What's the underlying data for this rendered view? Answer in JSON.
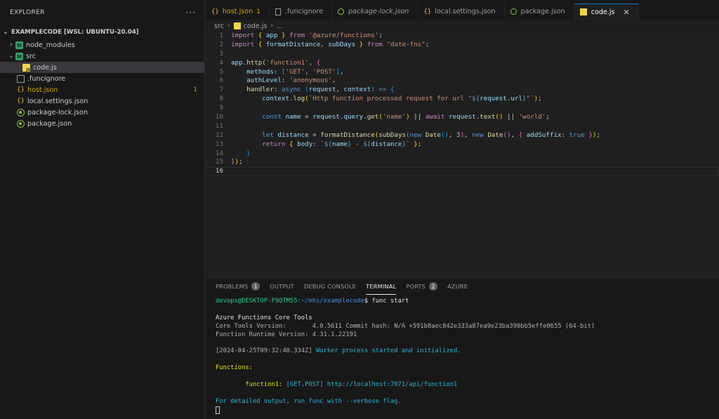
{
  "explorer": {
    "title": "EXPLORER",
    "more": "···",
    "workspace": "EXAMPLECODE [WSL: UBUNTU-20.04]",
    "items": [
      {
        "label": "node_modules",
        "icon": "folder-icon",
        "chevron": "›"
      },
      {
        "label": "src",
        "icon": "folder-icon",
        "chevron": "⌄"
      },
      {
        "label": "code.js",
        "icon": "js-file-icon"
      },
      {
        "label": ".funcignore",
        "icon": "file-icon"
      },
      {
        "label": "host.json",
        "icon": "json-icon",
        "badge": "1"
      },
      {
        "label": "local.settings.json",
        "icon": "json-icon"
      },
      {
        "label": "package-lock.json",
        "icon": "npm-icon"
      },
      {
        "label": "package.json",
        "icon": "npm-icon"
      }
    ]
  },
  "tabs": [
    {
      "label": "host.json",
      "icon": "{}",
      "badge": "1"
    },
    {
      "label": ".funcignore"
    },
    {
      "label": "package-lock.json"
    },
    {
      "label": "local.settings.json",
      "icon": "{}"
    },
    {
      "label": "package.json"
    },
    {
      "label": "code.js",
      "close": "✕"
    }
  ],
  "breadcrumb": {
    "folder": "src",
    "sep": "›",
    "file": "code.js",
    "sep2": "›",
    "rest": "..."
  },
  "editor": {
    "line_numbers": [
      "1",
      "2",
      "3",
      "4",
      "5",
      "6",
      "7",
      "8",
      "9",
      "10",
      "11",
      "12",
      "13",
      "14",
      "15",
      "16"
    ]
  },
  "panel": {
    "tabs": [
      {
        "label": "PROBLEMS",
        "badge": "1"
      },
      {
        "label": "OUTPUT"
      },
      {
        "label": "DEBUG CONSOLE"
      },
      {
        "label": "TERMINAL"
      },
      {
        "label": "PORTS",
        "badge": "2"
      },
      {
        "label": "AZURE"
      }
    ],
    "terminal": {
      "prompt_user": "devops@DESKTOP-F9QTM55",
      "prompt_path": ":~/mhs/examplecode",
      "prompt_cmd": "$ func start",
      "tools_title": "Azure Functions Core Tools",
      "core_version": "Core Tools Version:       4.0.5611 Commit hash: N/A +591b8aec842e333a87ea9e23ba390bb5effe0655 (64-bit)",
      "runtime_version": "Function Runtime Version: 4.31.1.22191",
      "worker_ts": "[2024-04-25T09:32:40.334Z]",
      "worker_msg": " Worker process started and initialized.",
      "functions_label": "Functions:",
      "fn_name": "        function1:",
      "fn_methods": " [GET,POST]",
      "fn_url": " http://localhost:7071/api/function1",
      "verbose_msg": "For detailed output, run func with --verbose flag."
    }
  }
}
